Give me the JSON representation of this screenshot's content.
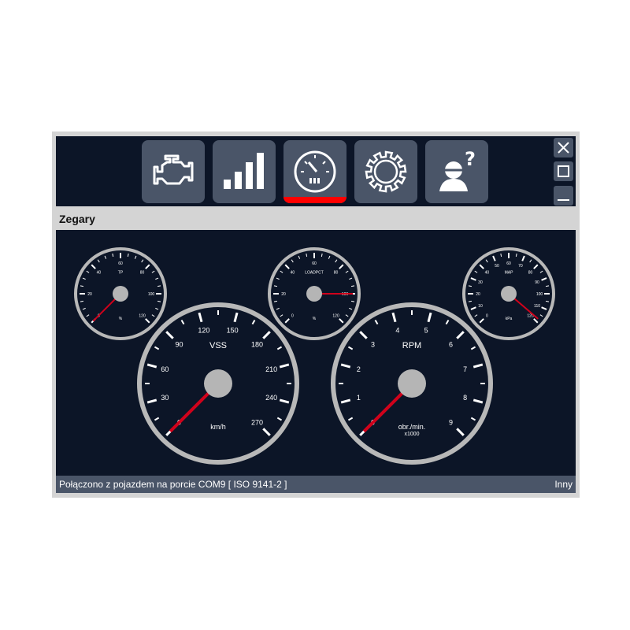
{
  "nav": {
    "items": [
      {
        "name": "engine",
        "icon": "engine-icon",
        "active": false
      },
      {
        "name": "charts",
        "icon": "bar-chart-icon",
        "active": false
      },
      {
        "name": "gauges",
        "icon": "gauge-icon",
        "active": true
      },
      {
        "name": "settings",
        "icon": "gear-icon",
        "active": false
      },
      {
        "name": "help",
        "icon": "user-help-icon",
        "active": false
      }
    ],
    "active_color": "#ff0000"
  },
  "window_controls": {
    "close": "✕",
    "maximize": "☐",
    "minimize": "—"
  },
  "section_title": "Zegary",
  "gauges": [
    {
      "id": "tp",
      "title": "TP",
      "unit": "%",
      "min": 0,
      "max": 120,
      "major": 20,
      "minor": 5,
      "value": 0,
      "labels": [
        "0",
        "20",
        "40",
        "60",
        "80",
        "100",
        "120"
      ]
    },
    {
      "id": "loadpct",
      "title": "LOADPCT",
      "unit": "%",
      "min": 0,
      "max": 120,
      "major": 20,
      "minor": 5,
      "value": 100,
      "labels": [
        "0",
        "20",
        "40",
        "60",
        "80",
        "100",
        "120"
      ]
    },
    {
      "id": "map",
      "title": "MAP",
      "unit": "kPa",
      "min": 0,
      "max": 120,
      "major": 10,
      "minor": 5,
      "value": 118,
      "labels": [
        "0",
        "10",
        "20",
        "30",
        "40",
        "50",
        "60",
        "70",
        "80",
        "90",
        "100",
        "110",
        "120"
      ]
    },
    {
      "id": "vss",
      "title": "VSS",
      "unit": "km/h",
      "min": 0,
      "max": 270,
      "major": 30,
      "minor": 15,
      "value": 0,
      "labels": [
        "0",
        "30",
        "60",
        "90",
        "120",
        "150",
        "180",
        "210",
        "240",
        "270"
      ]
    },
    {
      "id": "rpm",
      "title": "RPM",
      "unit": "obr./min.",
      "sub": "x1000",
      "min": 0,
      "max": 9,
      "major": 1,
      "minor": 0.5,
      "value": 0,
      "labels": [
        "0",
        "1",
        "2",
        "3",
        "4",
        "5",
        "6",
        "7",
        "8",
        "9"
      ]
    }
  ],
  "colors": {
    "needle": "#d0021b",
    "ring": "#b8b8b8",
    "background": "#0c1527"
  },
  "status": {
    "connection": "Połączono z pojazdem na porcie COM9  [ ISO 9141-2 ]",
    "right": "Inny"
  }
}
